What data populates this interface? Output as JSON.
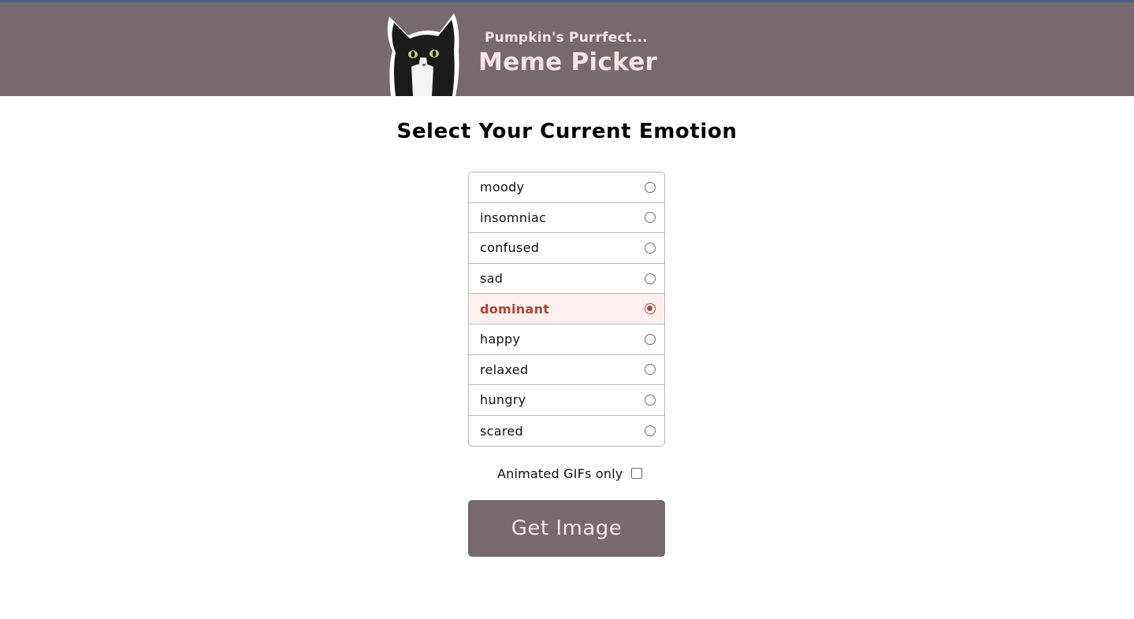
{
  "header": {
    "subtitle": "Pumpkin's Purrfect...",
    "title": "Meme Picker"
  },
  "main": {
    "heading": "Select Your Current Emotion",
    "emotions": [
      {
        "label": "moody",
        "selected": false
      },
      {
        "label": "insomniac",
        "selected": false
      },
      {
        "label": "confused",
        "selected": false
      },
      {
        "label": "sad",
        "selected": false
      },
      {
        "label": "dominant",
        "selected": true
      },
      {
        "label": "happy",
        "selected": false
      },
      {
        "label": "relaxed",
        "selected": false
      },
      {
        "label": "hungry",
        "selected": false
      },
      {
        "label": "scared",
        "selected": false
      }
    ],
    "gifs_only_label": "Animated GIFs only",
    "gifs_only_checked": false,
    "button_label": "Get Image"
  },
  "colors": {
    "header_bg": "#766a6e",
    "header_text": "#fbe3e6",
    "accent": "#b04433",
    "selected_bg": "#fcefee"
  }
}
